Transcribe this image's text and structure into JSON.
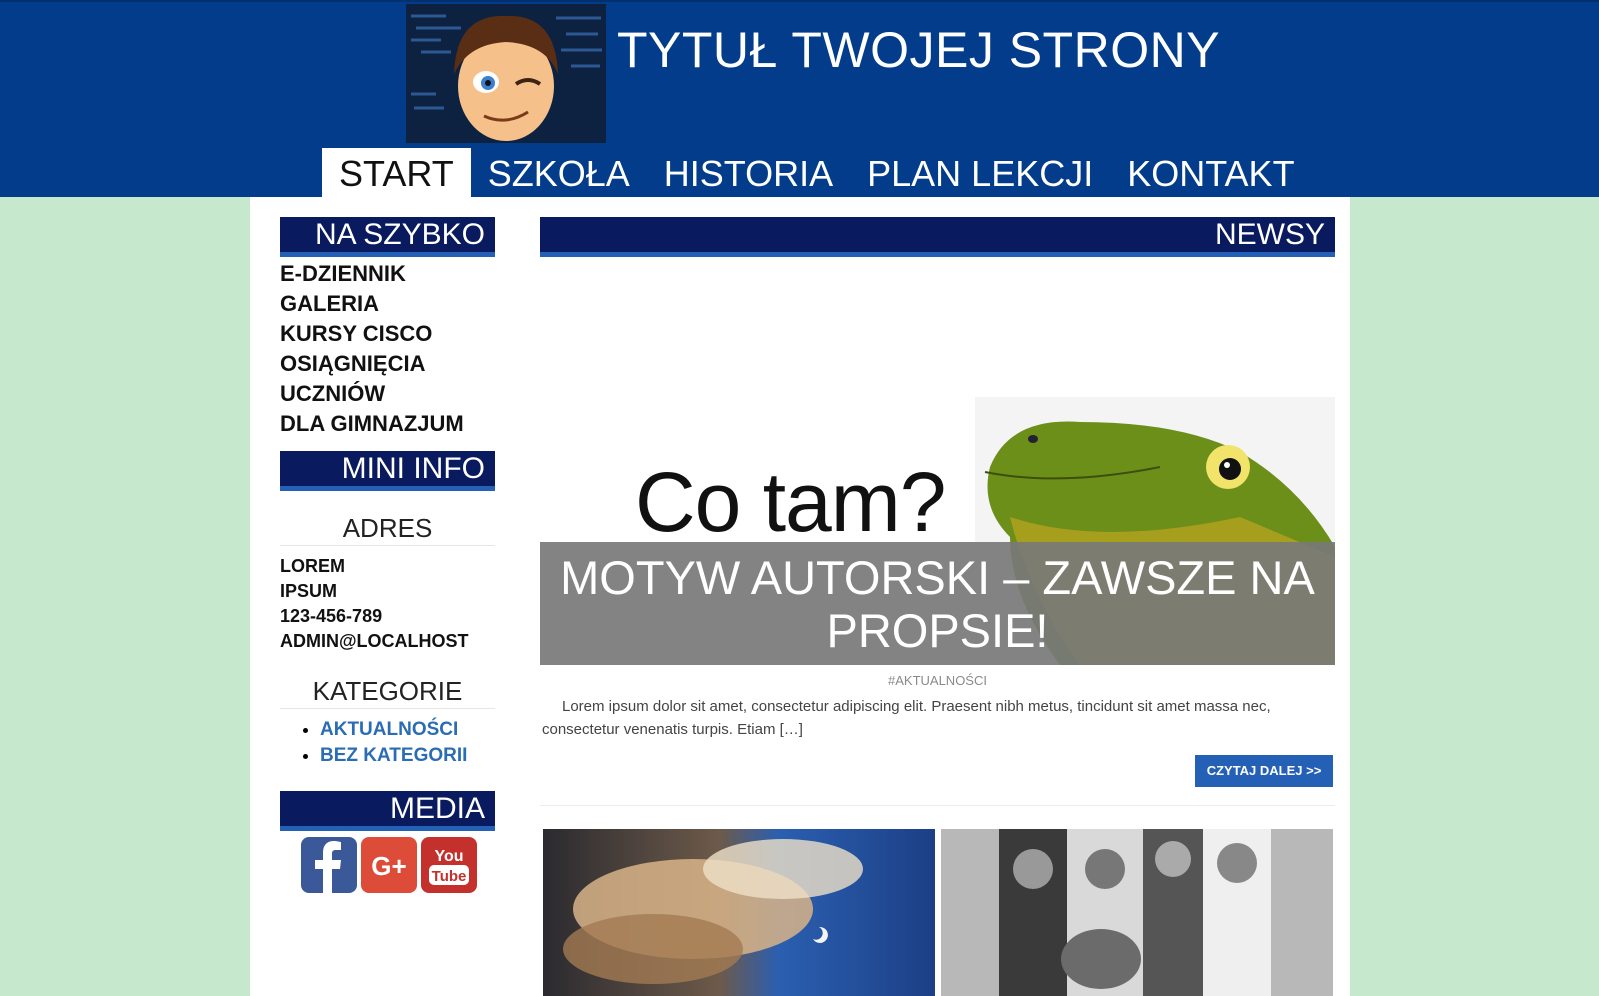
{
  "header": {
    "site_title": "TYTUŁ TWOJEJ STRONY",
    "logo_icon": "avatar-logo",
    "colors": {
      "header_bg": "#033c8a",
      "page_bg": "#c6e8cc"
    }
  },
  "nav": {
    "items": [
      {
        "label": "START",
        "active": true
      },
      {
        "label": "SZKOŁA"
      },
      {
        "label": "HISTORIA"
      },
      {
        "label": "PLAN LEKCJI"
      },
      {
        "label": "KONTAKT"
      }
    ]
  },
  "sidebar": {
    "quick": {
      "title": "NA SZYBKO",
      "links": [
        "E-DZIENNIK",
        "GALERIA",
        "KURSY CISCO",
        "OSIĄGNIĘCIA",
        "UCZNIÓW",
        "DLA GIMNAZJUM"
      ]
    },
    "mini_info": {
      "title": "MINI INFO",
      "address_title": "ADRES",
      "address": [
        "LOREM",
        "IPSUM",
        "123-456-789",
        "ADMIN@LOCALHOST"
      ],
      "categories_title": "KATEGORIE",
      "categories": [
        "AKTUALNOŚCI",
        "BEZ KATEGORII"
      ]
    },
    "media": {
      "title": "MEDIA",
      "icons": [
        "facebook-icon",
        "google-plus-icon",
        "youtube-icon"
      ]
    }
  },
  "main": {
    "title": "NEWSY",
    "post": {
      "image_text": "Co tam?",
      "title": "MOTYW AUTORSKI – ZAWSZE NA PROPSIE!",
      "tag": "#AKTUALNOŚCI",
      "excerpt": "Lorem ipsum dolor sit amet, consectetur adipiscing elit. Praesent nibh metus, tincidunt sit amet massa nec, consectetur venenatis turpis. Etiam […]",
      "read_more": "CZYTAJ DALEJ >>"
    }
  }
}
